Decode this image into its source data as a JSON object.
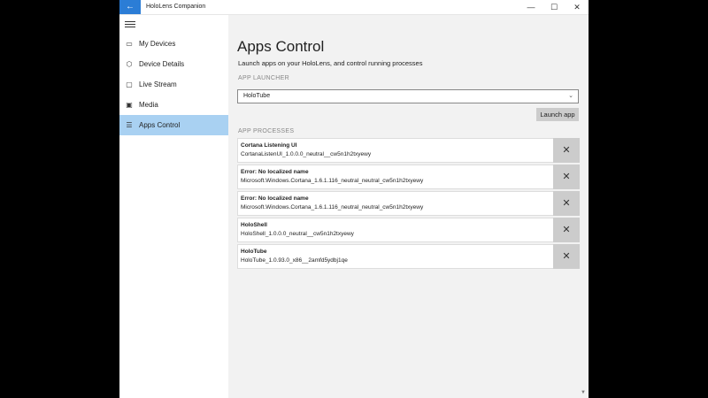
{
  "window": {
    "back_glyph": "←",
    "title": "HoloLens Companion",
    "minimize_glyph": "—",
    "maximize_glyph": "☐",
    "close_glyph": "✕"
  },
  "colors": {
    "accent": "#2b7dd6",
    "selected_nav": "#a9d1f2",
    "button_gray": "#cccccc"
  },
  "sidebar": {
    "items": [
      {
        "label": "My Devices",
        "icon": "device-list-icon",
        "glyph": "▭"
      },
      {
        "label": "Device Details",
        "icon": "device-details-icon",
        "glyph": "⬡"
      },
      {
        "label": "Live Stream",
        "icon": "live-stream-icon",
        "glyph": "▢"
      },
      {
        "label": "Media",
        "icon": "media-icon",
        "glyph": "▣"
      },
      {
        "label": "Apps Control",
        "icon": "apps-control-icon",
        "glyph": "☰"
      }
    ],
    "selected_index": 4
  },
  "main": {
    "title": "Apps Control",
    "subtitle": "Launch apps on your HoloLens, and control running processes",
    "launcher": {
      "header": "APP LAUNCHER",
      "selected_app": "HoloTube",
      "chevron_glyph": "⌄",
      "launch_label": "Launch app"
    },
    "processes": {
      "header": "APP PROCESSES",
      "close_glyph": "✕",
      "items": [
        {
          "name": "Cortana Listening UI",
          "id": "CortanaListenUI_1.0.0.0_neutral__cw5n1h2txyewy"
        },
        {
          "name": "Error: No localized name",
          "id": "Microsoft.Windows.Cortana_1.6.1.116_neutral_neutral_cw5n1h2txyewy"
        },
        {
          "name": "Error: No localized name",
          "id": "Microsoft.Windows.Cortana_1.6.1.116_neutral_neutral_cw5n1h2txyewy"
        },
        {
          "name": "HoloShell",
          "id": "HoloShell_1.0.0.0_neutral__cw5n1h2txyewy"
        },
        {
          "name": "HoloTube",
          "id": "HoloTube_1.0.93.0_x86__2amfd5ydbj1qe"
        }
      ]
    },
    "scroll_glyph": "▼"
  }
}
